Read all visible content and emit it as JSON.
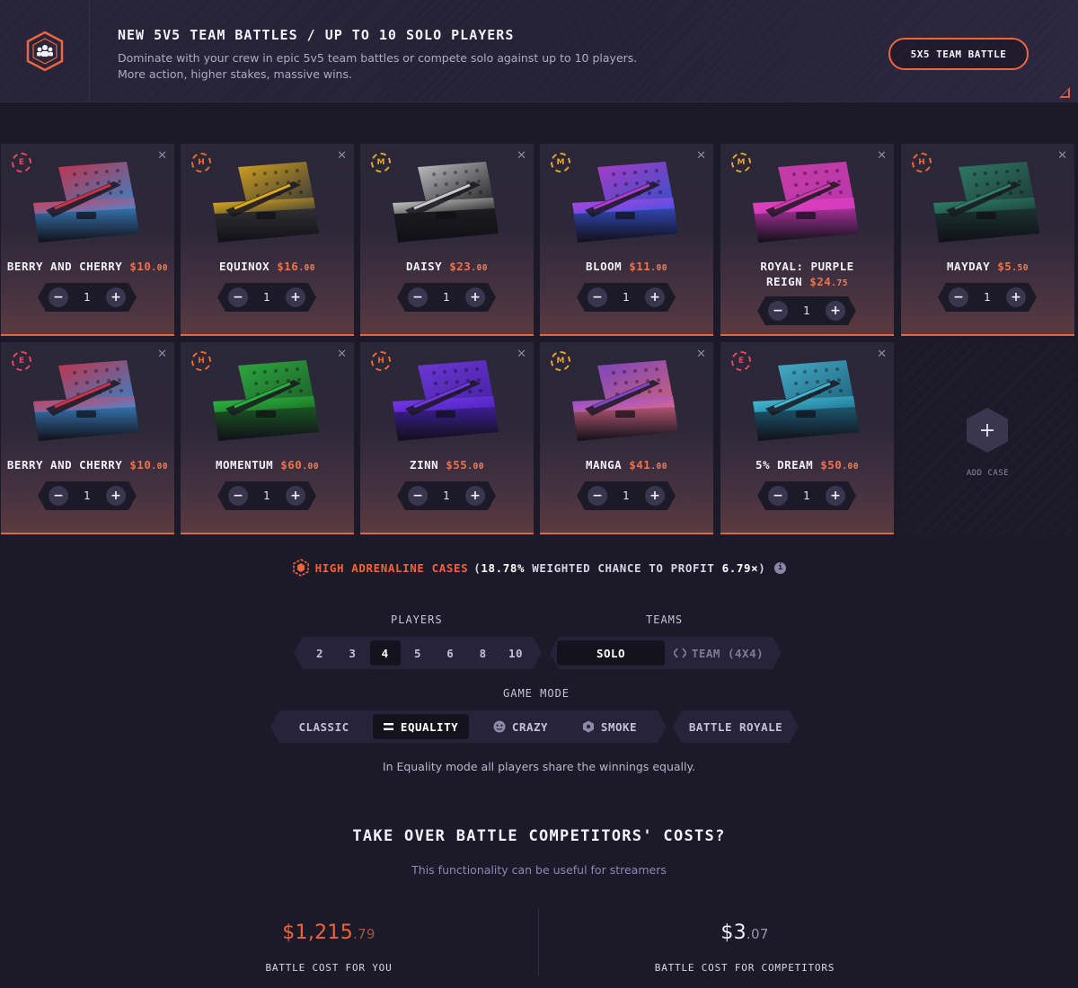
{
  "banner": {
    "title": "NEW 5V5 TEAM BATTLES / UP TO 10 SOLO PLAYERS",
    "desc_line1": "Dominate with your crew in epic 5v5 team battles or compete solo against up to 10 players.",
    "desc_line2": "More action, higher stakes, massive wins.",
    "button": "5X5 TEAM BATTLE",
    "icon": "team-icon"
  },
  "cases": [
    {
      "tier": "E",
      "name": "BERRY AND CHERRY",
      "price": "$10",
      "cents": ".00",
      "qty": "1",
      "art": [
        "#e0344f",
        "#3f8fd8"
      ]
    },
    {
      "tier": "H",
      "name": "EQUINOX",
      "price": "$16",
      "cents": ".00",
      "qty": "1",
      "art": [
        "#f0b818",
        "#3a3a3a"
      ]
    },
    {
      "tier": "M",
      "name": "DAISY",
      "price": "$23",
      "cents": ".00",
      "qty": "1",
      "art": [
        "#dcdcdc",
        "#202020"
      ]
    },
    {
      "tier": "M",
      "name": "BLOOM",
      "price": "$11",
      "cents": ".00",
      "qty": "1",
      "art": [
        "#c040e0",
        "#3a56e0"
      ]
    },
    {
      "tier": "M",
      "name": "ROYAL: PURPLE REIGN",
      "price": "$24",
      "cents": ".75",
      "qty": "1",
      "art": [
        "#e040b8",
        "#d23ac0"
      ]
    },
    {
      "tier": "H",
      "name": "MAYDAY",
      "price": "$5",
      "cents": ".50",
      "qty": "1",
      "art": [
        "#2f8a6e",
        "#1d3d3a"
      ]
    },
    {
      "tier": "E",
      "name": "BERRY AND CHERRY",
      "price": "$10",
      "cents": ".00",
      "qty": "1",
      "art": [
        "#e0344f",
        "#3f8fd8"
      ]
    },
    {
      "tier": "H",
      "name": "MOMENTUM",
      "price": "$60",
      "cents": ".00",
      "qty": "1",
      "art": [
        "#2cc040",
        "#1c6a26"
      ]
    },
    {
      "tier": "H",
      "name": "ZINN",
      "price": "$55",
      "cents": ".00",
      "qty": "1",
      "art": [
        "#7a3af0",
        "#4a22b8"
      ]
    },
    {
      "tier": "M",
      "name": "MANGA",
      "price": "$41",
      "cents": ".00",
      "qty": "1",
      "art": [
        "#8a4ad8",
        "#e06a8a"
      ]
    },
    {
      "tier": "E",
      "name": "5% DREAM",
      "price": "$50",
      "cents": ".00",
      "qty": "1",
      "art": [
        "#48c4e0",
        "#1e6e8a"
      ]
    }
  ],
  "add_case": {
    "label": "ADD CASE",
    "icon": "plus-icon"
  },
  "stats": {
    "accent_text": "HIGH ADRENALINE CASES",
    "paren_open": "(",
    "percent": "18.78%",
    "mid_text": "WEIGHTED CHANCE TO PROFIT",
    "multiplier": "6.79×",
    "paren_close": ")"
  },
  "players": {
    "label": "PLAYERS",
    "options": [
      "2",
      "3",
      "4",
      "5",
      "6",
      "8",
      "10"
    ],
    "selected": "4"
  },
  "teams": {
    "label": "TEAMS",
    "solo": "SOLO",
    "team": "TEAM (4X4)"
  },
  "game_mode": {
    "label": "GAME MODE",
    "classic": "CLASSIC",
    "equality": "EQUALITY",
    "crazy": "CRAZY",
    "smoke": "SMOKE",
    "battle_royale": "BATTLE ROYALE",
    "selected": "EQUALITY",
    "description": "In Equality mode all players share the winnings equally."
  },
  "takeover": {
    "title": "TAKE OVER BATTLE COMPETITORS' COSTS?",
    "subtitle": "This functionality can be useful for streamers"
  },
  "costs": {
    "you_amount": "$1,215",
    "you_cents": ".79",
    "you_caption": "BATTLE COST FOR YOU",
    "competitors_amount": "$3",
    "competitors_cents": ".07",
    "competitors_caption": "BATTLE COST FOR COMPETITORS"
  },
  "colors": {
    "accent": "#f0643c",
    "background": "#1c1a29"
  }
}
